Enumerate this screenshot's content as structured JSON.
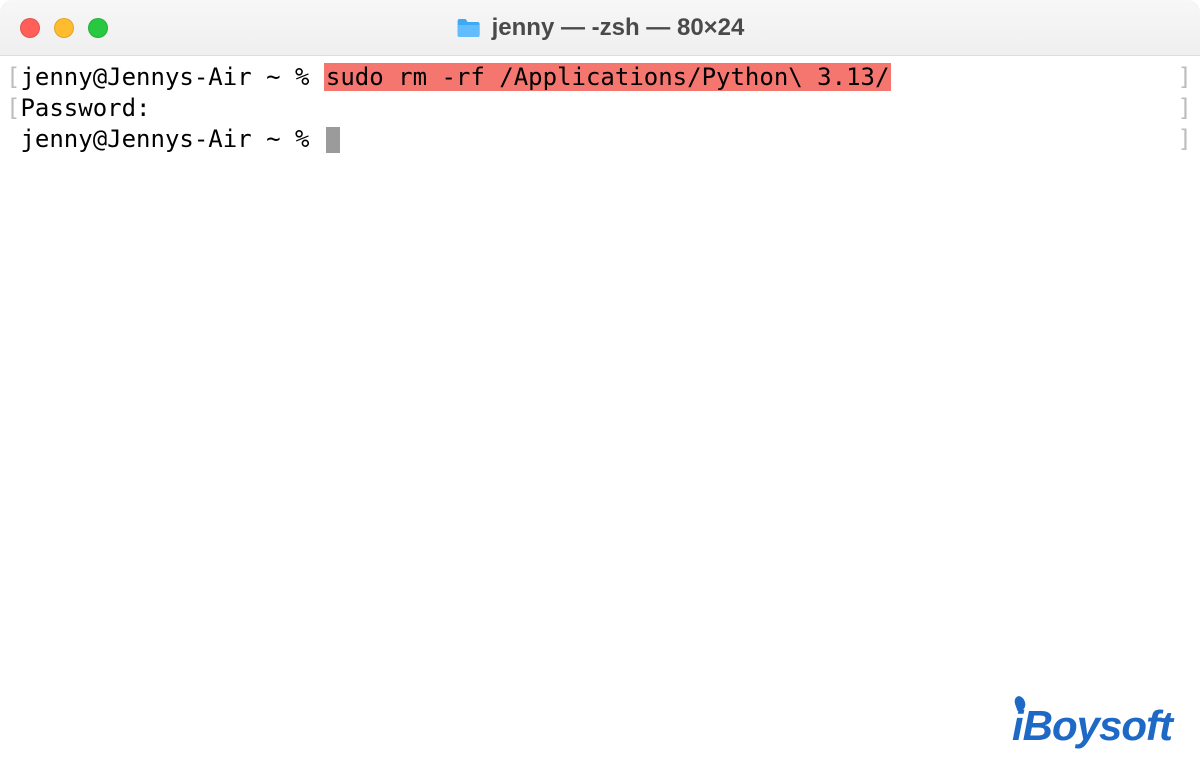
{
  "titlebar": {
    "title": "jenny — -zsh — 80×24",
    "folder_icon": "folder-icon"
  },
  "traffic": {
    "close": "close",
    "minimize": "minimize",
    "maximize": "maximize"
  },
  "terminal": {
    "lines": {
      "l1_prompt": "jenny@Jennys-Air ~ % ",
      "l1_cmd": "sudo rm -rf /Applications/Python\\ 3.13/",
      "l2": "Password:",
      "l3_prompt": "jenny@Jennys-Air ~ % "
    },
    "left_bracket": "[",
    "right_bracket": "]"
  },
  "watermark": {
    "text_i": "i",
    "text_rest": "Boysoft"
  },
  "colors": {
    "highlight_bg": "#f5766f",
    "brand": "#1e68c6"
  }
}
